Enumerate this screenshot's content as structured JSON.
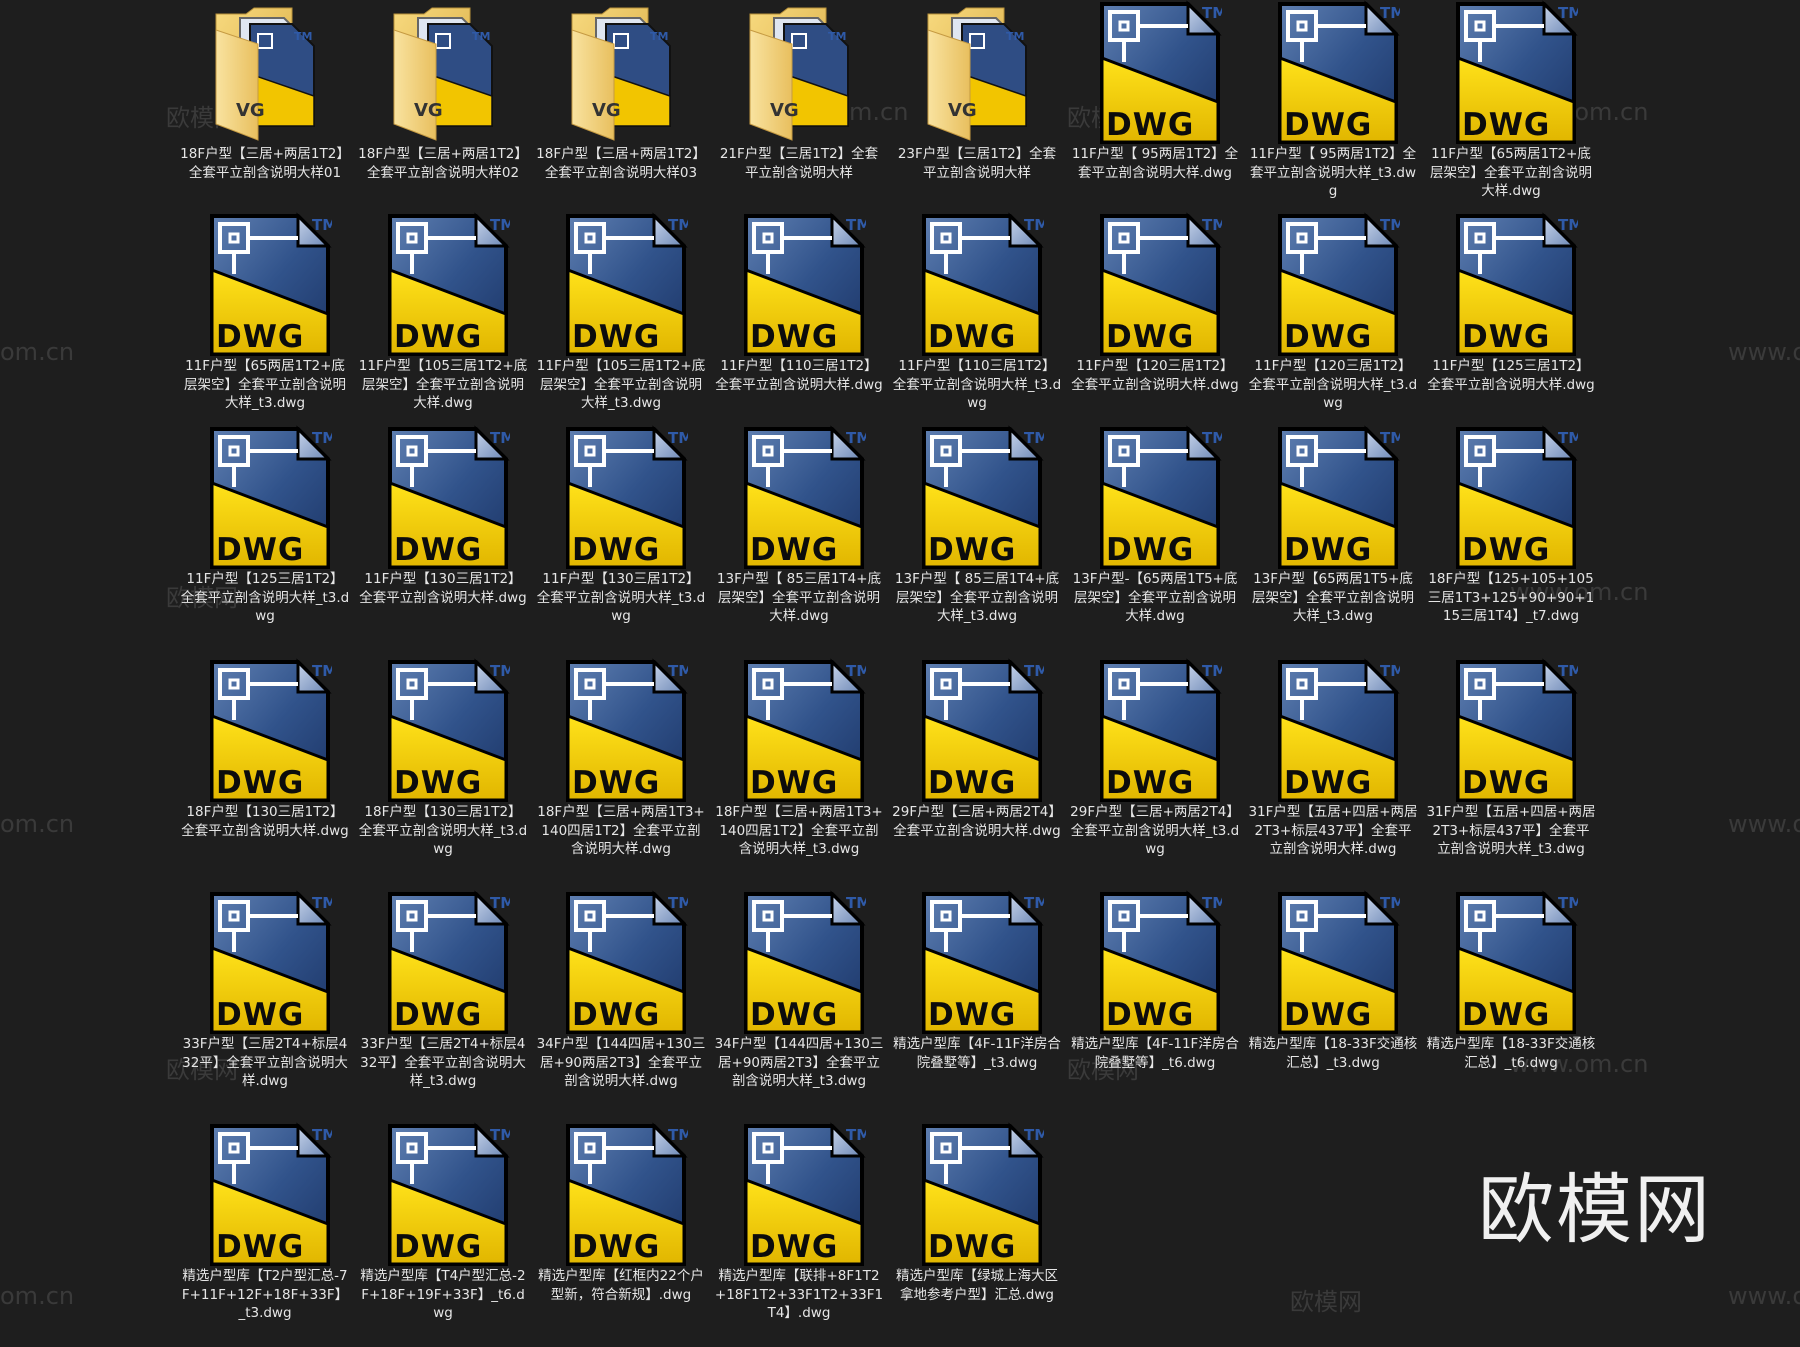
{
  "watermark": {
    "logo_text": "欧模网",
    "repeat_text_cn": "欧模网",
    "repeat_text_url": "www.om.cn",
    "repeat_text_url_left": "om.cn"
  },
  "files": [
    {
      "type": "folder",
      "name": "18F户型【三居+两居1T2】全套平立剖含说明大样01"
    },
    {
      "type": "folder",
      "name": "18F户型【三居+两居1T2】全套平立剖含说明大样02"
    },
    {
      "type": "folder",
      "name": "18F户型【三居+两居1T2】全套平立剖含说明大样03"
    },
    {
      "type": "folder",
      "name": "21F户型【三居1T2】全套平立剖含说明大样"
    },
    {
      "type": "folder",
      "name": "23F户型【三居1T2】全套平立剖含说明大样"
    },
    {
      "type": "dwg",
      "name": "11F户型【 95两居1T2】全套平立剖含说明大样.dwg"
    },
    {
      "type": "dwg",
      "name": "11F户型【 95两居1T2】全套平立剖含说明大样_t3.dwg"
    },
    {
      "type": "dwg",
      "name": "11F户型【65两居1T2+底层架空】全套平立剖含说明大样.dwg"
    },
    {
      "type": "dwg",
      "name": "11F户型【65两居1T2+底层架空】全套平立剖含说明大样_t3.dwg"
    },
    {
      "type": "dwg",
      "name": "11F户型【105三居1T2+底层架空】全套平立剖含说明大样.dwg"
    },
    {
      "type": "dwg",
      "name": "11F户型【105三居1T2+底层架空】全套平立剖含说明大样_t3.dwg"
    },
    {
      "type": "dwg",
      "name": "11F户型【110三居1T2】全套平立剖含说明大样.dwg"
    },
    {
      "type": "dwg",
      "name": "11F户型【110三居1T2】全套平立剖含说明大样_t3.dwg"
    },
    {
      "type": "dwg",
      "name": "11F户型【120三居1T2】全套平立剖含说明大样.dwg"
    },
    {
      "type": "dwg",
      "name": "11F户型【120三居1T2】全套平立剖含说明大样_t3.dwg"
    },
    {
      "type": "dwg",
      "name": "11F户型【125三居1T2】全套平立剖含说明大样.dwg"
    },
    {
      "type": "dwg",
      "name": "11F户型【125三居1T2】全套平立剖含说明大样_t3.dwg"
    },
    {
      "type": "dwg",
      "name": "11F户型【130三居1T2】全套平立剖含说明大样.dwg"
    },
    {
      "type": "dwg",
      "name": "11F户型【130三居1T2】全套平立剖含说明大样_t3.dwg"
    },
    {
      "type": "dwg",
      "name": "13F户型【 85三居1T4+底层架空】全套平立剖含说明大样.dwg"
    },
    {
      "type": "dwg",
      "name": "13F户型【 85三居1T4+底层架空】全套平立剖含说明大样_t3.dwg"
    },
    {
      "type": "dwg",
      "name": "13F户型-【65两居1T5+底层架空】全套平立剖含说明大样.dwg"
    },
    {
      "type": "dwg",
      "name": "13F户型【65两居1T5+底层架空】全套平立剖含说明大样_t3.dwg"
    },
    {
      "type": "dwg",
      "name": "18F户型【125+105+105三居1T3+125+90+90+115三居1T4】_t7.dwg"
    },
    {
      "type": "dwg",
      "name": "18F户型【130三居1T2】全套平立剖含说明大样.dwg"
    },
    {
      "type": "dwg",
      "name": "18F户型【130三居1T2】全套平立剖含说明大样_t3.dwg"
    },
    {
      "type": "dwg",
      "name": "18F户型【三居+两居1T3+140四居1T2】全套平立剖含说明大样.dwg"
    },
    {
      "type": "dwg",
      "name": "18F户型【三居+两居1T3+140四居1T2】全套平立剖含说明大样_t3.dwg"
    },
    {
      "type": "dwg",
      "name": "29F户型【三居+两居2T4】全套平立剖含说明大样.dwg"
    },
    {
      "type": "dwg",
      "name": "29F户型【三居+两居2T4】全套平立剖含说明大样_t3.dwg"
    },
    {
      "type": "dwg",
      "name": "31F户型【五居+四居+两居2T3+标层437平】全套平立剖含说明大样.dwg"
    },
    {
      "type": "dwg",
      "name": "31F户型【五居+四居+两居2T3+标层437平】全套平立剖含说明大样_t3.dwg"
    },
    {
      "type": "dwg",
      "name": "33F户型【三居2T4+标层432平】全套平立剖含说明大样.dwg"
    },
    {
      "type": "dwg",
      "name": "33F户型【三居2T4+标层432平】全套平立剖含说明大样_t3.dwg"
    },
    {
      "type": "dwg",
      "name": "34F户型【144四居+130三居+90两居2T3】全套平立剖含说明大样.dwg"
    },
    {
      "type": "dwg",
      "name": "34F户型【144四居+130三居+90两居2T3】全套平立剖含说明大样_t3.dwg"
    },
    {
      "type": "dwg",
      "name": "精选户型库【4F-11F洋房合院叠墅等】_t3.dwg"
    },
    {
      "type": "dwg",
      "name": "精选户型库【4F-11F洋房合院叠墅等】_t6.dwg"
    },
    {
      "type": "dwg",
      "name": "精选户型库【18-33F交通核汇总】_t3.dwg"
    },
    {
      "type": "dwg",
      "name": "精选户型库【18-33F交通核汇总】_t6.dwg"
    },
    {
      "type": "dwg",
      "name": "精选户型库【T2户型汇总-7F+11F+12F+18F+33F】_t3.dwg"
    },
    {
      "type": "dwg",
      "name": "精选户型库【T4户型汇总-2F+18F+19F+33F】_t6.dwg"
    },
    {
      "type": "dwg",
      "name": "精选户型库【红框内22个户型新，符合新规】.dwg"
    },
    {
      "type": "dwg",
      "name": "精选户型库【联排+8F1T2+18F1T2+33F1T2+33F1T4】.dwg"
    },
    {
      "type": "dwg",
      "name": "精选户型库【绿城上海大区拿地参考户型】汇总.dwg"
    }
  ]
}
